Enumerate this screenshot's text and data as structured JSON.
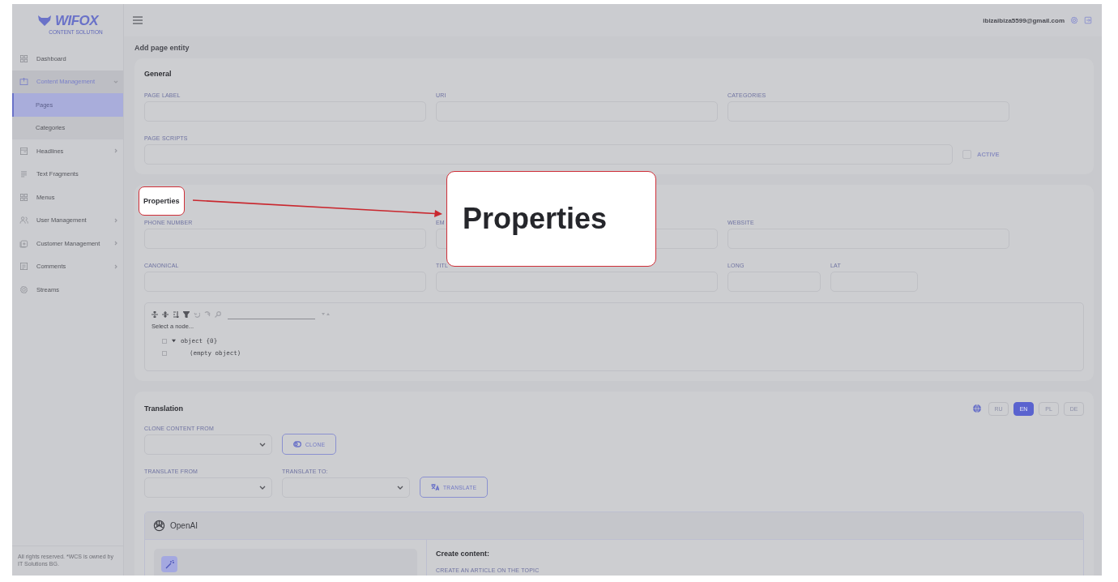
{
  "header": {
    "user_email": "ibizaibiza5599@gmail.com"
  },
  "sidebar": {
    "logo": "WIFOX",
    "logo_tagline": "CONTENT SOLUTION",
    "items": [
      {
        "label": "Dashboard",
        "expandable": false,
        "expanded": false,
        "selected": false
      },
      {
        "label": "Content Management",
        "expandable": true,
        "expanded": true,
        "selected": true,
        "children": [
          {
            "label": "Pages",
            "selected": true
          },
          {
            "label": "Categories",
            "selected": false
          }
        ]
      },
      {
        "label": "Headlines",
        "expandable": true,
        "expanded": false,
        "selected": false
      },
      {
        "label": "Text Fragments",
        "expandable": false,
        "expanded": false,
        "selected": false
      },
      {
        "label": "Menus",
        "expandable": false,
        "expanded": false,
        "selected": false
      },
      {
        "label": "User Management",
        "expandable": true,
        "expanded": false,
        "selected": false
      },
      {
        "label": "Customer Management",
        "expandable": true,
        "expanded": false,
        "selected": false
      },
      {
        "label": "Comments",
        "expandable": true,
        "expanded": false,
        "selected": false
      },
      {
        "label": "Streams",
        "expandable": false,
        "expanded": false,
        "selected": false
      }
    ],
    "footer": "All rights reserved. *WCS is owned by IT Solutions BG."
  },
  "page_title": "Add page entity",
  "general": {
    "title": "General",
    "rows": [
      [
        {
          "label": "PAGE LABEL"
        },
        {
          "label": "URI"
        },
        {
          "label": "CATEGORIES"
        }
      ],
      [
        {
          "label": "PAGE SCRIPTS"
        }
      ]
    ],
    "active": {
      "label": "ACTIVE",
      "checked": false
    }
  },
  "properties": {
    "title": "Properties",
    "highlighted": true,
    "rows": [
      [
        {
          "label": "PHONE NUMBER"
        },
        {
          "label": "EM"
        },
        {
          "label": "WEBSITE"
        }
      ],
      [
        {
          "label": "CANONICAL"
        },
        {
          "label": "TITL"
        },
        {
          "label": "LONG"
        },
        {
          "label": "LAT"
        }
      ]
    ],
    "json_editor": {
      "hint": "Select a node...",
      "nodes": [
        {
          "label": "object {0}",
          "checked": false,
          "expanded": true,
          "children": [
            {
              "label": "(empty object)",
              "checked": false
            }
          ]
        }
      ]
    }
  },
  "translation": {
    "title": "Translation",
    "languages": [
      {
        "code": "RU",
        "selected": false
      },
      {
        "code": "EN",
        "selected": true
      },
      {
        "code": "PL",
        "selected": false
      },
      {
        "code": "DE",
        "selected": false
      }
    ],
    "clone_label": "CLONE CONTENT FROM",
    "clone_button": "CLONE",
    "translate_from_label": "TRANSLATE FROM",
    "translate_to_label": "TRANSLATE TO:",
    "translate_button": "TRANSLATE",
    "openai": {
      "title": "OpenAI",
      "create_title": "Create content:",
      "prompt_label": "CREATE AN ARTICLE ON THE TOPIC"
    }
  },
  "callout": {
    "text": "Properties"
  }
}
